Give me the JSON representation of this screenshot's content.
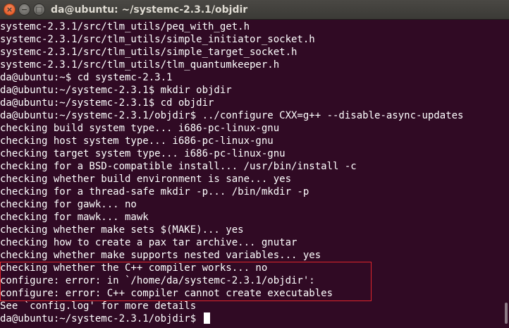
{
  "window": {
    "title": "da@ubuntu: ~/systemc-2.3.1/objdir",
    "close_glyph": "×",
    "minimize_glyph": "−",
    "maximize_glyph": "□"
  },
  "colors": {
    "terminal_background": "#300a24",
    "terminal_text": "#ffffff",
    "highlight_box": "#e0242b",
    "close_button": "#e0501c"
  },
  "terminal": {
    "lines": [
      "systemc-2.3.1/src/tlm_utils/peq_with_get.h",
      "systemc-2.3.1/src/tlm_utils/simple_initiator_socket.h",
      "systemc-2.3.1/src/tlm_utils/simple_target_socket.h",
      "systemc-2.3.1/src/tlm_utils/tlm_quantumkeeper.h",
      "da@ubuntu:~$ cd systemc-2.3.1",
      "da@ubuntu:~/systemc-2.3.1$ mkdir objdir",
      "da@ubuntu:~/systemc-2.3.1$ cd objdir",
      "da@ubuntu:~/systemc-2.3.1/objdir$ ../configure CXX=g++ --disable-async-updates",
      "checking build system type... i686-pc-linux-gnu",
      "checking host system type... i686-pc-linux-gnu",
      "checking target system type... i686-pc-linux-gnu",
      "checking for a BSD-compatible install... /usr/bin/install -c",
      "checking whether build environment is sane... yes",
      "checking for a thread-safe mkdir -p... /bin/mkdir -p",
      "checking for gawk... no",
      "checking for mawk... mawk",
      "checking whether make sets $(MAKE)... yes",
      "checking how to create a pax tar archive... gnutar",
      "checking whether make supports nested variables... yes",
      "checking whether the C++ compiler works... no",
      "configure: error: in `/home/da/systemc-2.3.1/objdir':",
      "configure: error: C++ compiler cannot create executables",
      "See `config.log' for more details",
      "da@ubuntu:~/systemc-2.3.1/objdir$ "
    ]
  }
}
